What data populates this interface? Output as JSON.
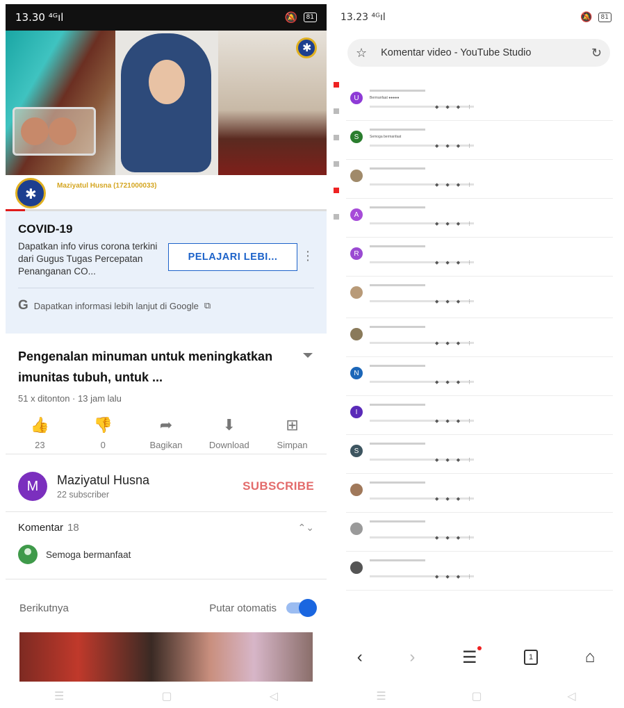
{
  "left": {
    "status": {
      "time": "13.30",
      "signal": "⁴ᴳıl",
      "battery": "81"
    },
    "ad_channel_name": "Maziyatul Husna (1721000033)",
    "progress_pct": 6,
    "covid": {
      "title": "COVID-19",
      "description": "Dapatkan info virus corona terkini dari Gugus Tugas Percepatan Penanganan CO...",
      "learn_more": "PELAJARI LEBI...",
      "google_link": "Dapatkan informasi lebih lanjut di Google"
    },
    "video": {
      "title": "Pengenalan minuman untuk meningkatkan imunitas tubuh, untuk ...",
      "meta": "51 x ditonton · 13 jam lalu"
    },
    "actions": [
      {
        "icon": "thumbs-up-icon",
        "label": "23"
      },
      {
        "icon": "thumbs-down-icon",
        "label": "0"
      },
      {
        "icon": "share-icon",
        "label": "Bagikan"
      },
      {
        "icon": "download-icon",
        "label": "Download"
      },
      {
        "icon": "save-icon",
        "label": "Simpan"
      }
    ],
    "channel": {
      "initial": "M",
      "name": "Maziyatul Husna",
      "subscribers": "22 subscriber",
      "subscribe_label": "SUBSCRIBE"
    },
    "comments": {
      "label": "Komentar",
      "count": "18",
      "top_comment": "Semoga bermanfaat"
    },
    "next": {
      "label": "Berikutnya",
      "autoplay_label": "Putar otomatis"
    }
  },
  "right": {
    "status": {
      "time": "13.23",
      "signal": "⁴ᴳıl",
      "battery": "81"
    },
    "url_title": "Komentar video - YouTube Studio",
    "comments": [
      {
        "initial": "U",
        "color": "#8e3bd6",
        "text": "Bermanfaat ●●●●●"
      },
      {
        "initial": "S",
        "color": "#2a7d2e",
        "text": "Semoga bermanfaat"
      },
      {
        "initial": "",
        "color": "#a08a6a",
        "text": ""
      },
      {
        "initial": "A",
        "color": "#a64bd8",
        "text": ""
      },
      {
        "initial": "R",
        "color": "#9a4ad2",
        "text": ""
      },
      {
        "initial": "",
        "color": "#b89a78",
        "text": ""
      },
      {
        "initial": "",
        "color": "#8a7a5a",
        "text": ""
      },
      {
        "initial": "N",
        "color": "#1b66b8",
        "text": ""
      },
      {
        "initial": "I",
        "color": "#5a2ab8",
        "text": ""
      },
      {
        "initial": "S",
        "color": "#3d5560",
        "text": ""
      },
      {
        "initial": "",
        "color": "#a0785a",
        "text": ""
      },
      {
        "initial": "",
        "color": "#9a9a9a",
        "text": ""
      },
      {
        "initial": "",
        "color": "#555555",
        "text": ""
      }
    ],
    "nav": {
      "tabs_count": "1"
    }
  }
}
